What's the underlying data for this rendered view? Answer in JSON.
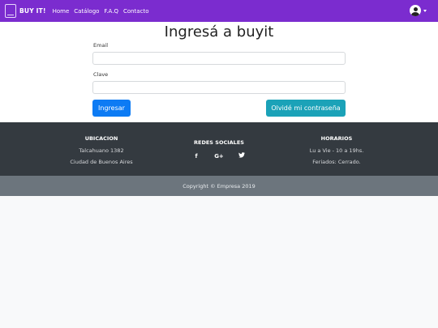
{
  "navbar": {
    "brand": "BUY IT!",
    "links": [
      "Home",
      "Catálogo",
      "F.A.Q",
      "Contacto"
    ]
  },
  "form": {
    "title": "Ingresá a buyit",
    "email_label": "Email",
    "email_value": "",
    "password_label": "Clave",
    "password_value": "",
    "submit_label": "Ingresar",
    "forgot_label": "Olvidé mi contraseña"
  },
  "footer": {
    "location": {
      "title": "UBICACION",
      "line1": "Talcahuano 1382",
      "line2": "Ciudad de Buenos Aires"
    },
    "social": {
      "title": "REDES SOCIALES",
      "icons": [
        "facebook-icon",
        "google-plus-icon",
        "twitter-icon"
      ]
    },
    "hours": {
      "title": "HORARIOS",
      "line1": "Lu a Vie - 10 a 19hs.",
      "line2": "Feriados: Cerrado."
    },
    "copyright": "Copyright © Empresa 2019"
  },
  "colors": {
    "navbar": "#7b2ccf",
    "primary": "#0d7bf4",
    "info": "#1ba2b8",
    "footer_dark": "#343a40",
    "footer_gray": "#6c757d"
  }
}
